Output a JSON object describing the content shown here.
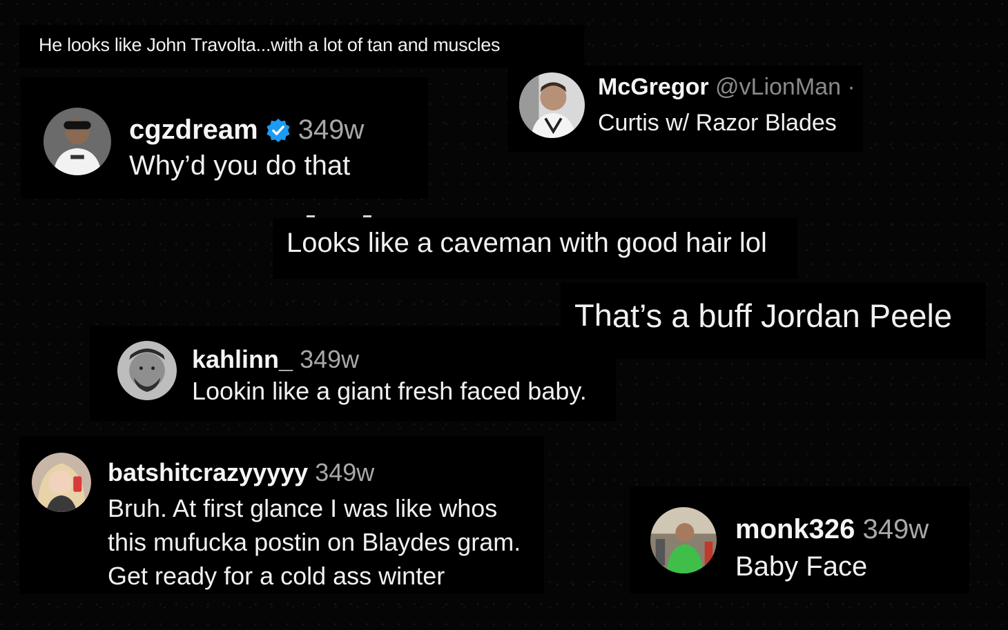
{
  "comments": [
    {
      "text": "He looks like John Travolta...with a lot of tan and muscles"
    },
    {
      "username": "cgzdream",
      "verified": true,
      "age": "349w",
      "text": "Why’d you do that",
      "avatar_icon": "user-avatar-icon"
    },
    {
      "username": "McGregor",
      "handle": "@vLionMan ·",
      "text": "Curtis w/ Razor Blades",
      "avatar_icon": "user-avatar-icon"
    },
    {
      "text": "Looks like a caveman with good hair lol"
    },
    {
      "text": "That’s a buff Jordan Peele"
    },
    {
      "username": "kahlinn_",
      "age": "349w",
      "text": "Lookin like a giant fresh faced baby.",
      "avatar_icon": "user-avatar-icon"
    },
    {
      "username": "batshitcrazyyyyy",
      "age": "349w",
      "text": "Bruh. At first glance I was like whos this mufucka postin on Blaydes gram. Get ready for a cold ass winter",
      "avatar_icon": "user-avatar-icon"
    },
    {
      "username": "monk326",
      "age": "349w",
      "text": "Baby Face",
      "avatar_icon": "user-avatar-icon"
    }
  ],
  "colors": {
    "background": "#000000",
    "text": "#f1f1f1",
    "meta": "#a8a8a8",
    "verified": "#1d9bf0"
  }
}
